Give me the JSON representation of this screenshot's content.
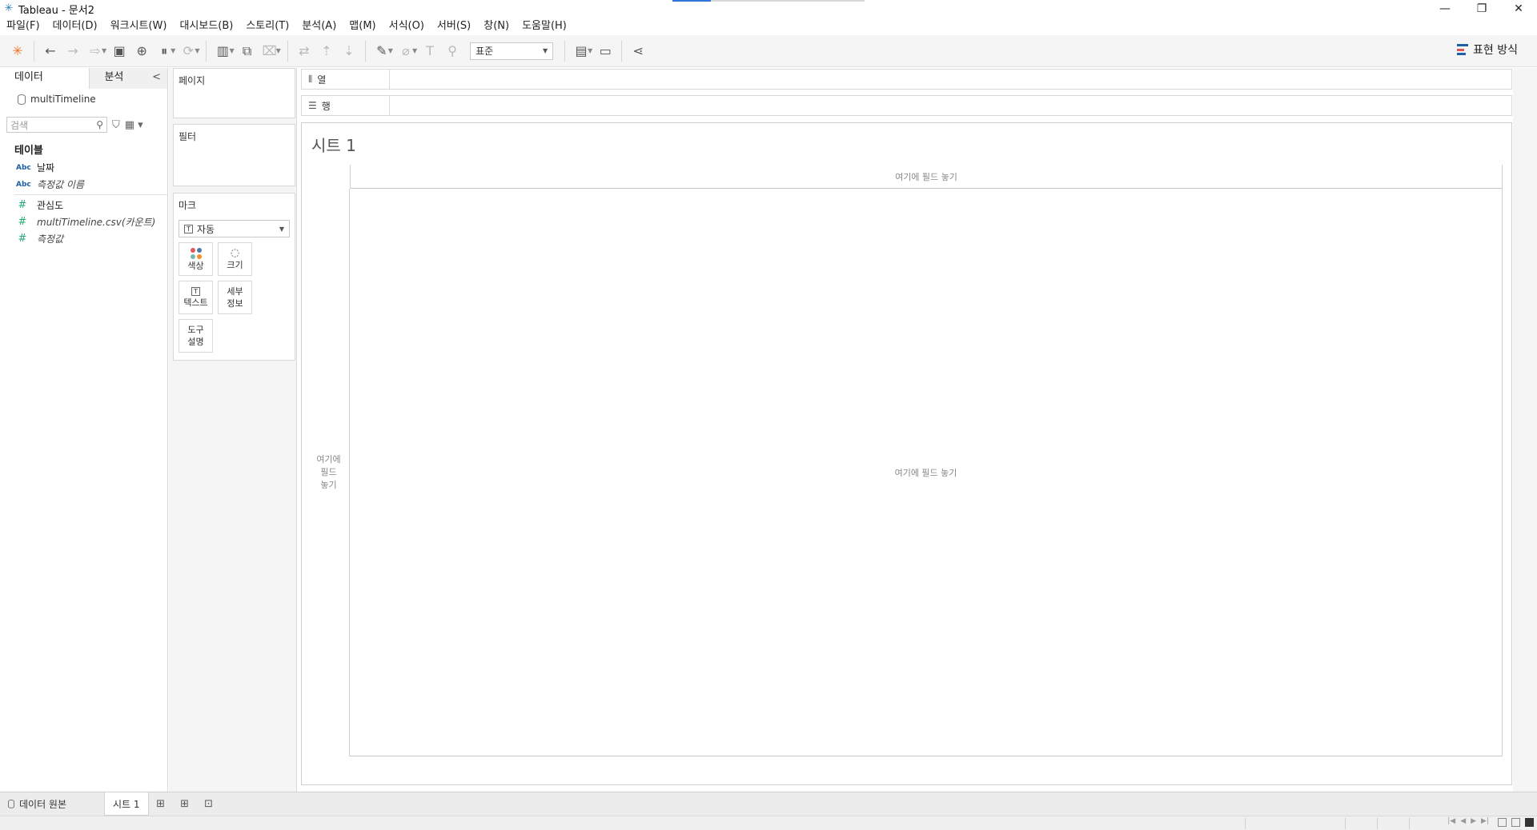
{
  "window": {
    "title": "Tableau - 문서2",
    "minimize": "—",
    "restore": "❐",
    "close": "✕"
  },
  "menubar": [
    "파일(F)",
    "데이터(D)",
    "워크시트(W)",
    "대시보드(B)",
    "스토리(T)",
    "분석(A)",
    "맵(M)",
    "서식(O)",
    "서버(S)",
    "창(N)",
    "도움말(H)"
  ],
  "toolbar": {
    "fit_select": "표준",
    "show_me": "표현 방식"
  },
  "data_pane": {
    "tabs": {
      "data": "데이터",
      "analysis": "분석",
      "collapse": "<"
    },
    "datasource": "multiTimeline",
    "search_placeholder": "검색",
    "section": "테이블",
    "dimensions": [
      {
        "type": "Abc",
        "name": "날짜",
        "italic": false
      },
      {
        "type": "Abc",
        "name": "측정값 이름",
        "italic": true
      }
    ],
    "measures": [
      {
        "type": "#",
        "name": "관심도",
        "italic": false
      },
      {
        "type": "#",
        "name": "multiTimeline.csv(카운트)",
        "italic": true
      },
      {
        "type": "#",
        "name": "측정값",
        "italic": true
      }
    ]
  },
  "cards": {
    "pages": "페이지",
    "filters": "필터",
    "marks": "마크",
    "marks_type": "자동",
    "mark_buttons": {
      "color": "색상",
      "size": "크기",
      "text": "텍스트",
      "detail_1": "세부",
      "detail_2": "정보",
      "tooltip_1": "도구",
      "tooltip_2": "설명"
    }
  },
  "shelves": {
    "columns": "열",
    "rows": "행"
  },
  "viz": {
    "sheet_title": "시트 1",
    "drop_top": "여기에 필드 놓기",
    "drop_left_1": "여기에",
    "drop_left_2": "필드",
    "drop_left_3": "놓기",
    "drop_main": "여기에 필드 놓기"
  },
  "sheet_tabs": {
    "data_source": "데이터 원본",
    "sheet1": "시트 1"
  },
  "colors": {
    "accent": "#1f5fa8",
    "measure": "#2aa876"
  },
  "progress_fraction": 0.2
}
